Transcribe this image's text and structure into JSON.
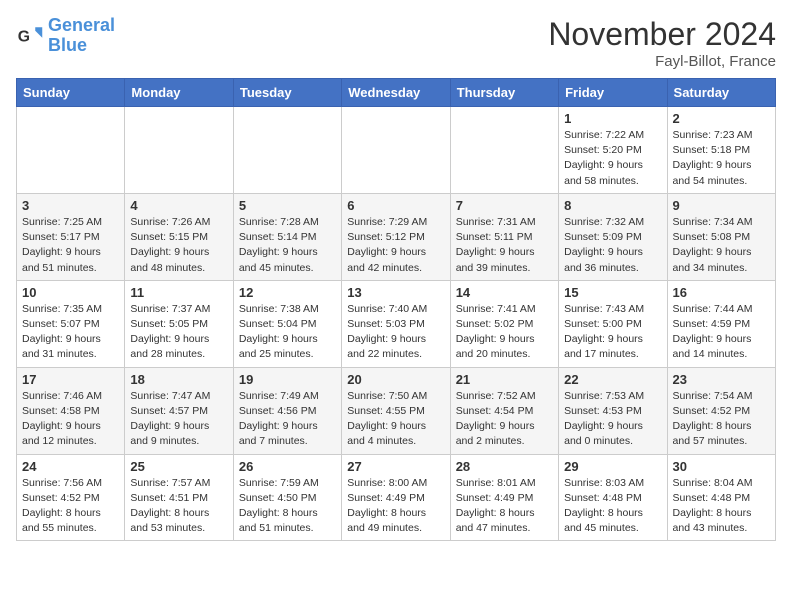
{
  "logo": {
    "line1": "General",
    "line2": "Blue"
  },
  "title": "November 2024",
  "location": "Fayl-Billot, France",
  "days_of_week": [
    "Sunday",
    "Monday",
    "Tuesday",
    "Wednesday",
    "Thursday",
    "Friday",
    "Saturday"
  ],
  "weeks": [
    [
      {
        "day": "",
        "info": ""
      },
      {
        "day": "",
        "info": ""
      },
      {
        "day": "",
        "info": ""
      },
      {
        "day": "",
        "info": ""
      },
      {
        "day": "",
        "info": ""
      },
      {
        "day": "1",
        "info": "Sunrise: 7:22 AM\nSunset: 5:20 PM\nDaylight: 9 hours and 58 minutes."
      },
      {
        "day": "2",
        "info": "Sunrise: 7:23 AM\nSunset: 5:18 PM\nDaylight: 9 hours and 54 minutes."
      }
    ],
    [
      {
        "day": "3",
        "info": "Sunrise: 7:25 AM\nSunset: 5:17 PM\nDaylight: 9 hours and 51 minutes."
      },
      {
        "day": "4",
        "info": "Sunrise: 7:26 AM\nSunset: 5:15 PM\nDaylight: 9 hours and 48 minutes."
      },
      {
        "day": "5",
        "info": "Sunrise: 7:28 AM\nSunset: 5:14 PM\nDaylight: 9 hours and 45 minutes."
      },
      {
        "day": "6",
        "info": "Sunrise: 7:29 AM\nSunset: 5:12 PM\nDaylight: 9 hours and 42 minutes."
      },
      {
        "day": "7",
        "info": "Sunrise: 7:31 AM\nSunset: 5:11 PM\nDaylight: 9 hours and 39 minutes."
      },
      {
        "day": "8",
        "info": "Sunrise: 7:32 AM\nSunset: 5:09 PM\nDaylight: 9 hours and 36 minutes."
      },
      {
        "day": "9",
        "info": "Sunrise: 7:34 AM\nSunset: 5:08 PM\nDaylight: 9 hours and 34 minutes."
      }
    ],
    [
      {
        "day": "10",
        "info": "Sunrise: 7:35 AM\nSunset: 5:07 PM\nDaylight: 9 hours and 31 minutes."
      },
      {
        "day": "11",
        "info": "Sunrise: 7:37 AM\nSunset: 5:05 PM\nDaylight: 9 hours and 28 minutes."
      },
      {
        "day": "12",
        "info": "Sunrise: 7:38 AM\nSunset: 5:04 PM\nDaylight: 9 hours and 25 minutes."
      },
      {
        "day": "13",
        "info": "Sunrise: 7:40 AM\nSunset: 5:03 PM\nDaylight: 9 hours and 22 minutes."
      },
      {
        "day": "14",
        "info": "Sunrise: 7:41 AM\nSunset: 5:02 PM\nDaylight: 9 hours and 20 minutes."
      },
      {
        "day": "15",
        "info": "Sunrise: 7:43 AM\nSunset: 5:00 PM\nDaylight: 9 hours and 17 minutes."
      },
      {
        "day": "16",
        "info": "Sunrise: 7:44 AM\nSunset: 4:59 PM\nDaylight: 9 hours and 14 minutes."
      }
    ],
    [
      {
        "day": "17",
        "info": "Sunrise: 7:46 AM\nSunset: 4:58 PM\nDaylight: 9 hours and 12 minutes."
      },
      {
        "day": "18",
        "info": "Sunrise: 7:47 AM\nSunset: 4:57 PM\nDaylight: 9 hours and 9 minutes."
      },
      {
        "day": "19",
        "info": "Sunrise: 7:49 AM\nSunset: 4:56 PM\nDaylight: 9 hours and 7 minutes."
      },
      {
        "day": "20",
        "info": "Sunrise: 7:50 AM\nSunset: 4:55 PM\nDaylight: 9 hours and 4 minutes."
      },
      {
        "day": "21",
        "info": "Sunrise: 7:52 AM\nSunset: 4:54 PM\nDaylight: 9 hours and 2 minutes."
      },
      {
        "day": "22",
        "info": "Sunrise: 7:53 AM\nSunset: 4:53 PM\nDaylight: 9 hours and 0 minutes."
      },
      {
        "day": "23",
        "info": "Sunrise: 7:54 AM\nSunset: 4:52 PM\nDaylight: 8 hours and 57 minutes."
      }
    ],
    [
      {
        "day": "24",
        "info": "Sunrise: 7:56 AM\nSunset: 4:52 PM\nDaylight: 8 hours and 55 minutes."
      },
      {
        "day": "25",
        "info": "Sunrise: 7:57 AM\nSunset: 4:51 PM\nDaylight: 8 hours and 53 minutes."
      },
      {
        "day": "26",
        "info": "Sunrise: 7:59 AM\nSunset: 4:50 PM\nDaylight: 8 hours and 51 minutes."
      },
      {
        "day": "27",
        "info": "Sunrise: 8:00 AM\nSunset: 4:49 PM\nDaylight: 8 hours and 49 minutes."
      },
      {
        "day": "28",
        "info": "Sunrise: 8:01 AM\nSunset: 4:49 PM\nDaylight: 8 hours and 47 minutes."
      },
      {
        "day": "29",
        "info": "Sunrise: 8:03 AM\nSunset: 4:48 PM\nDaylight: 8 hours and 45 minutes."
      },
      {
        "day": "30",
        "info": "Sunrise: 8:04 AM\nSunset: 4:48 PM\nDaylight: 8 hours and 43 minutes."
      }
    ]
  ]
}
